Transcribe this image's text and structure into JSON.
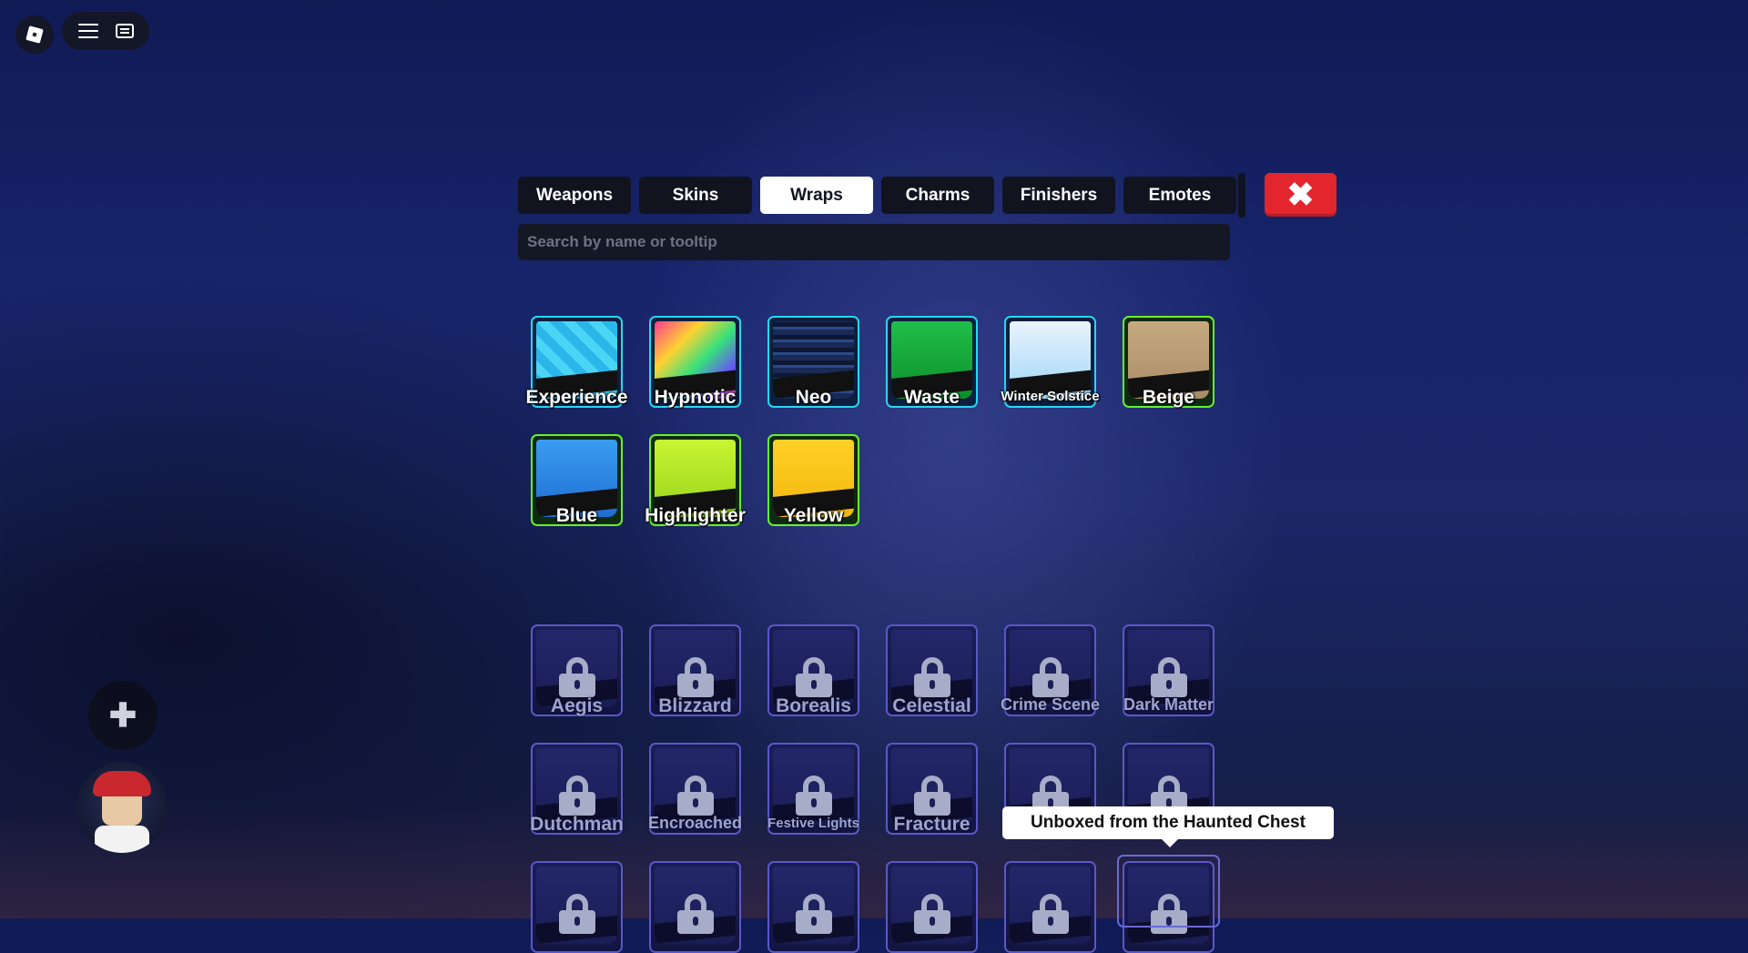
{
  "topbar": {
    "logo_icon": "roblox-logo-icon",
    "menu_icon": "hamburger-menu-icon",
    "chat_icon": "chat-icon"
  },
  "tabs": [
    {
      "label": "Weapons",
      "active": false
    },
    {
      "label": "Skins",
      "active": false
    },
    {
      "label": "Wraps",
      "active": true
    },
    {
      "label": "Charms",
      "active": false
    },
    {
      "label": "Finishers",
      "active": false
    },
    {
      "label": "Emotes",
      "active": false
    }
  ],
  "close_button": {
    "icon": "close-x-icon",
    "color": "#e3262e",
    "glyph": "✖"
  },
  "search": {
    "placeholder": "Search by name or tooltip",
    "value": ""
  },
  "owned_wraps": [
    {
      "name": "Experience",
      "rarity": "cyan"
    },
    {
      "name": "Hypnotic",
      "rarity": "cyan"
    },
    {
      "name": "Neo",
      "rarity": "cyan"
    },
    {
      "name": "Waste",
      "rarity": "cyan"
    },
    {
      "name": "Winter Solstice",
      "rarity": "cyan"
    },
    {
      "name": "Beige",
      "rarity": "green"
    },
    {
      "name": "Blue",
      "rarity": "green"
    },
    {
      "name": "Highlighter",
      "rarity": "green"
    },
    {
      "name": "Yellow",
      "rarity": "green"
    }
  ],
  "locked_wraps": [
    "Aegis",
    "Blizzard",
    "Borealis",
    "Celestial",
    "Crime Scene",
    "Dark Matter",
    "Dutchman",
    "Encroached",
    "Festive Lights",
    "Fracture",
    "",
    "",
    "",
    "",
    "",
    "",
    "",
    ""
  ],
  "tooltip": {
    "text": "Unboxed from the Haunted Chest"
  },
  "left_controls": {
    "plus_glyph": "✚",
    "plus_icon": "add-plus-icon",
    "avatar": "player-avatar"
  },
  "colors": {
    "cyan_border": "#26d8f0",
    "green_border": "#66f22b",
    "locked_border": "#5a58c9",
    "active_tab_bg": "#ffffff",
    "tab_bg": "#11141f"
  }
}
